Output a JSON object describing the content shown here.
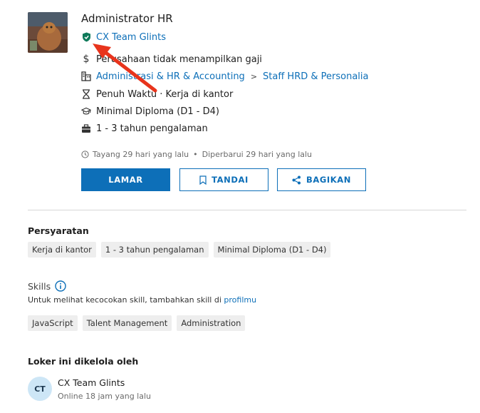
{
  "job": {
    "title": "Administrator HR",
    "company": "CX Team Glints",
    "salary": "Perusahaan tidak menampilkan gaji",
    "category": "Administrasi & HR & Accounting",
    "category_separator": ">",
    "subcategory": "Staff HRD & Personalia",
    "work_type": "Penuh Waktu · Kerja di kantor",
    "education": "Minimal Diploma (D1 - D4)",
    "experience": "1 - 3 tahun pengalaman",
    "posted": "Tayang 29 hari yang lalu",
    "meta_separator": "•",
    "updated": "Diperbarui 29 hari yang lalu"
  },
  "actions": {
    "apply": "LAMAR",
    "save": "TANDAI",
    "share": "BAGIKAN"
  },
  "requirements": {
    "title": "Persyaratan",
    "items": [
      "Kerja di kantor",
      "1 - 3 tahun pengalaman",
      "Minimal Diploma (D1 - D4)"
    ]
  },
  "skills": {
    "title": "Skills",
    "hint_text": "Untuk melihat kecocokan skill, tambahkan skill di",
    "hint_link": "profilmu",
    "items": [
      "JavaScript",
      "Talent Management",
      "Administration"
    ]
  },
  "manager": {
    "title": "Loker ini dikelola oleh",
    "initials": "CT",
    "name": "CX Team Glints",
    "status": "Online 18 jam yang lalu"
  },
  "colors": {
    "accent": "#0d6fb8",
    "verified": "#0f7a5a",
    "annotation_arrow": "#e8341c"
  },
  "icons": [
    "company-logo",
    "verified-shield-icon",
    "dollar-icon",
    "category-icon",
    "hourglass-icon",
    "graduation-cap-icon",
    "briefcase-icon",
    "clock-icon",
    "bookmark-icon",
    "share-icon",
    "info-icon",
    "annotation-arrow"
  ]
}
